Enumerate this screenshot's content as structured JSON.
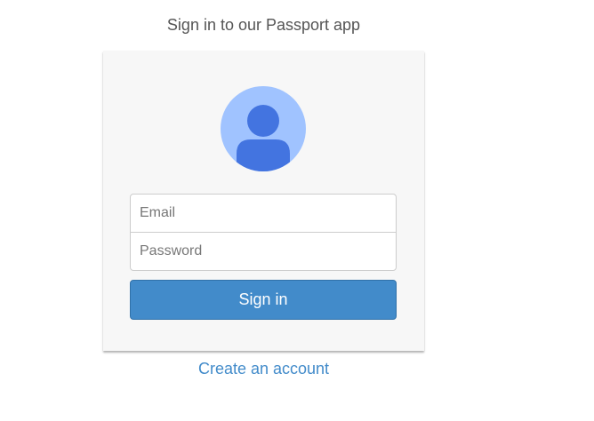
{
  "header": {
    "title": "Sign in to our Passport app"
  },
  "form": {
    "avatar_icon": "user-avatar-icon",
    "email": {
      "placeholder": "Email",
      "value": ""
    },
    "password": {
      "placeholder": "Password",
      "value": ""
    },
    "submit_label": "Sign in"
  },
  "footer": {
    "create_account_label": "Create an account"
  },
  "colors": {
    "accent": "#428bca",
    "avatar_bg": "#a0c3ff",
    "avatar_figure": "#4374e0",
    "card_bg": "#f7f7f7"
  }
}
